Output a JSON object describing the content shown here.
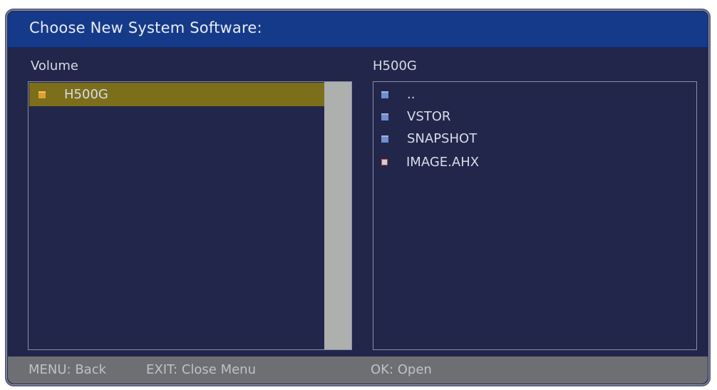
{
  "dialog": {
    "title": "Choose New System Software:"
  },
  "left_panel": {
    "header": "Volume",
    "items": [
      {
        "label": "H500G",
        "icon": "drive-folder-icon",
        "selected": true
      }
    ]
  },
  "right_panel": {
    "header": "H500G",
    "items": [
      {
        "label": "..",
        "icon": "folder-icon"
      },
      {
        "label": "VSTOR",
        "icon": "folder-icon"
      },
      {
        "label": "SNAPSHOT",
        "icon": "folder-icon"
      },
      {
        "label": "IMAGE.AHX",
        "icon": "file-icon"
      }
    ]
  },
  "footer": {
    "menu_hint": "MENU: Back",
    "exit_hint": "EXIT: Close Menu",
    "ok_hint": "OK: Open"
  },
  "colors": {
    "title_bar": "#163a8a",
    "background": "#22264a",
    "selection": "#7d6e1b",
    "footer": "#6d6f72"
  }
}
